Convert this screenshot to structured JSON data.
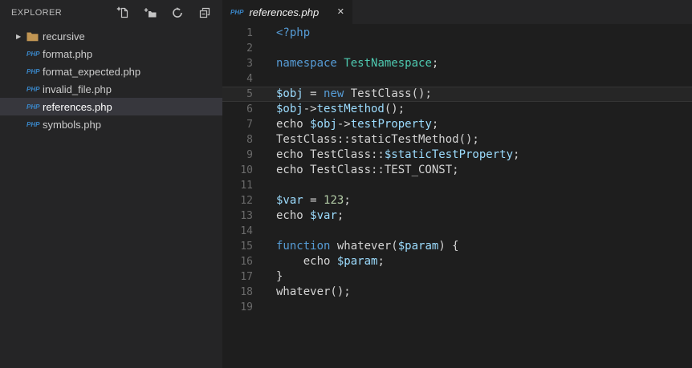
{
  "colors": {
    "k": "#569cd6",
    "c": "#4ec9b0",
    "v": "#9cdcfe",
    "d": "#d4d4d4",
    "n": "#b5cea8",
    "php": "#3a87c9",
    "folder": "#c09553",
    "icon": "#c5c5c5"
  },
  "explorer": {
    "title": "EXPLORER",
    "php_badge": "PHP",
    "actions": [
      {
        "name": "new-file"
      },
      {
        "name": "new-folder"
      },
      {
        "name": "refresh"
      },
      {
        "name": "collapse-all"
      }
    ],
    "files": [
      {
        "label": "recursive",
        "type": "folder",
        "expandable": true
      },
      {
        "label": "format.php",
        "type": "php"
      },
      {
        "label": "format_expected.php",
        "type": "php"
      },
      {
        "label": "invalid_file.php",
        "type": "php"
      },
      {
        "label": "references.php",
        "type": "php",
        "selected": true
      },
      {
        "label": "symbols.php",
        "type": "php"
      }
    ]
  },
  "tab": {
    "icon": "PHP",
    "title": "references.php",
    "close": "✕"
  },
  "editor": {
    "lines": [
      {
        "no": 1,
        "tokens": [
          [
            "<?php",
            "k"
          ]
        ]
      },
      {
        "no": 2,
        "tokens": []
      },
      {
        "no": 3,
        "tokens": [
          [
            "namespace",
            "k"
          ],
          [
            " ",
            "d"
          ],
          [
            "TestNamespace",
            "c"
          ],
          [
            ";",
            "d"
          ]
        ]
      },
      {
        "no": 4,
        "tokens": []
      },
      {
        "no": 5,
        "highlight": true,
        "tokens": [
          [
            "$obj",
            "v"
          ],
          [
            " = ",
            "d"
          ],
          [
            "new",
            "k"
          ],
          [
            " TestClass();",
            "d"
          ]
        ]
      },
      {
        "no": 6,
        "tokens": [
          [
            "$obj",
            "v"
          ],
          [
            "->",
            "d"
          ],
          [
            "testMethod",
            "v"
          ],
          [
            "();",
            "d"
          ]
        ]
      },
      {
        "no": 7,
        "tokens": [
          [
            "echo ",
            "d"
          ],
          [
            "$obj",
            "v"
          ],
          [
            "->",
            "d"
          ],
          [
            "testProperty",
            "v"
          ],
          [
            ";",
            "d"
          ]
        ]
      },
      {
        "no": 8,
        "tokens": [
          [
            "TestClass::staticTestMethod();",
            "d"
          ]
        ]
      },
      {
        "no": 9,
        "tokens": [
          [
            "echo TestClass::",
            "d"
          ],
          [
            "$staticTestProperty",
            "v"
          ],
          [
            ";",
            "d"
          ]
        ]
      },
      {
        "no": 10,
        "tokens": [
          [
            "echo TestClass::TEST_CONST;",
            "d"
          ]
        ]
      },
      {
        "no": 11,
        "tokens": []
      },
      {
        "no": 12,
        "tokens": [
          [
            "$var",
            "v"
          ],
          [
            " = ",
            "d"
          ],
          [
            "123",
            "n"
          ],
          [
            ";",
            "d"
          ]
        ]
      },
      {
        "no": 13,
        "tokens": [
          [
            "echo ",
            "d"
          ],
          [
            "$var",
            "v"
          ],
          [
            ";",
            "d"
          ]
        ]
      },
      {
        "no": 14,
        "tokens": []
      },
      {
        "no": 15,
        "tokens": [
          [
            "function",
            "k"
          ],
          [
            " whatever(",
            "d"
          ],
          [
            "$param",
            "v"
          ],
          [
            ") {",
            "d"
          ]
        ]
      },
      {
        "no": 16,
        "tokens": [
          [
            "    echo ",
            "d"
          ],
          [
            "$param",
            "v"
          ],
          [
            ";",
            "d"
          ]
        ]
      },
      {
        "no": 17,
        "tokens": [
          [
            "}",
            "d"
          ]
        ]
      },
      {
        "no": 18,
        "tokens": [
          [
            "whatever();",
            "d"
          ]
        ]
      },
      {
        "no": 19,
        "tokens": []
      }
    ]
  }
}
